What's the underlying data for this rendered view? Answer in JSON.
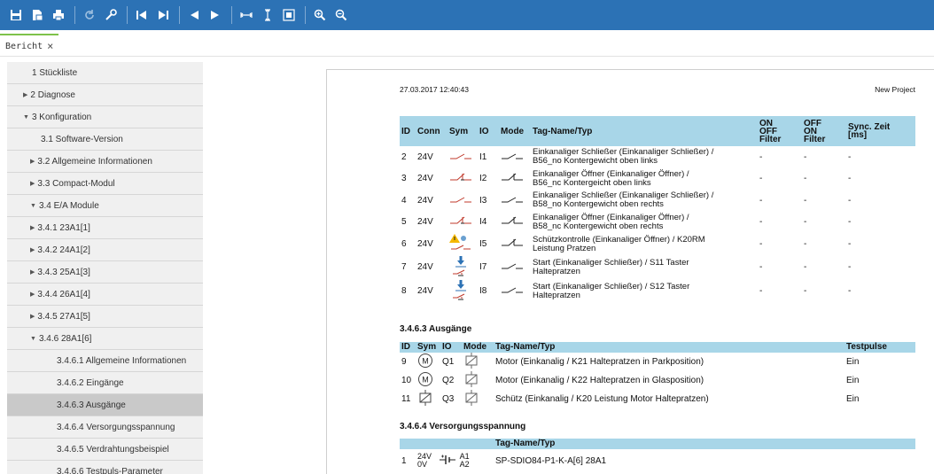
{
  "toolbar": {
    "buttons": [
      "save-icon",
      "export-pdf-icon",
      "print-icon",
      "refresh-icon",
      "settings-wrench-icon",
      "first-page-icon",
      "last-page-icon",
      "previous-page-icon",
      "next-page-icon",
      "fit-width-icon",
      "fit-height-icon",
      "fit-page-icon",
      "zoom-in-icon",
      "zoom-out-icon"
    ]
  },
  "tab": {
    "label": "Bericht",
    "close": "×"
  },
  "sidebar": {
    "items": [
      {
        "label": "1 Stückliste",
        "arrow": ""
      },
      {
        "label": "2 Diagnose",
        "arrow": "▶"
      },
      {
        "label": "3 Konfiguration",
        "arrow": "▼"
      },
      {
        "label": "3.1 Software-Version",
        "arrow": ""
      },
      {
        "label": "3.2 Allgemeine Informationen",
        "arrow": "▶"
      },
      {
        "label": "3.3 Compact-Modul",
        "arrow": "▶"
      },
      {
        "label": "3.4 E/A Module",
        "arrow": "▼"
      },
      {
        "label": "3.4.1 23A1[1]",
        "arrow": "▶"
      },
      {
        "label": "3.4.2 24A1[2]",
        "arrow": "▶"
      },
      {
        "label": "3.4.3 25A1[3]",
        "arrow": "▶"
      },
      {
        "label": "3.4.4 26A1[4]",
        "arrow": "▶"
      },
      {
        "label": "3.4.5 27A1[5]",
        "arrow": "▶"
      },
      {
        "label": "3.4.6 28A1[6]",
        "arrow": "▼"
      },
      {
        "label": "3.4.6.1 Allgemeine Informationen",
        "arrow": ""
      },
      {
        "label": "3.4.6.2 Eingänge",
        "arrow": ""
      },
      {
        "label": "3.4.6.3 Ausgänge",
        "arrow": ""
      },
      {
        "label": "3.4.6.4 Versorgungsspannung",
        "arrow": ""
      },
      {
        "label": "3.4.6.5 Verdrahtungsbeispiel",
        "arrow": ""
      },
      {
        "label": "3.4.6.6 Testpuls-Parameter",
        "arrow": ""
      }
    ]
  },
  "report": {
    "timestamp": "27.03.2017 12:40:43",
    "project": "New Project",
    "inputs": {
      "headers": {
        "id": "ID",
        "conn": "Conn",
        "sym": "Sym",
        "io": "IO",
        "mode": "Mode",
        "tag": "Tag-Name/Typ",
        "on_off_1": "ON",
        "on_off_2": "OFF",
        "on_off_3": "Filter",
        "off_on_1": "OFF",
        "off_on_2": "ON",
        "off_on_3": "Filter",
        "sync_1": "Sync. Zeit",
        "sync_2": "[ms]"
      },
      "rows": [
        {
          "id": "2",
          "conn": "24V",
          "io": "I1",
          "tag1": "Einkanaliger Schließer (Einkanaliger Schließer) /",
          "tag2": "B56_no Kontergewicht oben links",
          "on": "-",
          "off": "-",
          "sync": "-"
        },
        {
          "id": "3",
          "conn": "24V",
          "io": "I2",
          "tag1": "Einkanaliger Öffner (Einkanaliger Öffner) /",
          "tag2": "B56_nc Kontergeicht oben links",
          "on": "-",
          "off": "-",
          "sync": "-"
        },
        {
          "id": "4",
          "conn": "24V",
          "io": "I3",
          "tag1": "Einkanaliger Schließer (Einkanaliger Schließer) /",
          "tag2": "B58_no Kontergewicht oben rechts",
          "on": "-",
          "off": "-",
          "sync": "-"
        },
        {
          "id": "5",
          "conn": "24V",
          "io": "I4",
          "tag1": "Einkanaliger Öffner (Einkanaliger Öffner) /",
          "tag2": "B58_nc Kontergewicht oben rechts",
          "on": "-",
          "off": "-",
          "sync": "-"
        },
        {
          "id": "6",
          "conn": "24V",
          "io": "I5",
          "tag1": "Schützkontrolle (Einkanaliger Öffner) / K20RM",
          "tag2": "Leistung Pratzen",
          "on": "-",
          "off": "-",
          "sync": "-"
        },
        {
          "id": "7",
          "conn": "24V",
          "io": "I7",
          "tag1": "Start (Einkanaliger Schließer) / S11 Taster",
          "tag2": "Haltepratzen",
          "on": "-",
          "off": "-",
          "sync": "-"
        },
        {
          "id": "8",
          "conn": "24V",
          "io": "I8",
          "tag1": "Start (Einkanaliger Schließer) / S12 Taster",
          "tag2": "Haltepratzen",
          "on": "-",
          "off": "-",
          "sync": "-"
        }
      ]
    },
    "outputs": {
      "title": "3.4.6.3 Ausgänge",
      "headers": {
        "id": "ID",
        "sym": "Sym",
        "io": "IO",
        "mode": "Mode",
        "tag": "Tag-Name/Typ",
        "testpulse": "Testpulse"
      },
      "rows": [
        {
          "id": "9",
          "io": "Q1",
          "tag": "Motor (Einkanalig / K21 Haltepratzen in Parkposition)",
          "testpulse": "Ein"
        },
        {
          "id": "10",
          "io": "Q2",
          "tag": "Motor (Einkanalig / K22 Haltepratzen in Glasposition)",
          "testpulse": "Ein"
        },
        {
          "id": "11",
          "io": "Q3",
          "tag": "Schütz (Einkanalig / K20 Leistung Motor Haltepratzen)",
          "testpulse": "Ein"
        }
      ]
    },
    "supply": {
      "title": "3.4.6.4 Versorgungsspannung",
      "header_tag": "Tag-Name/Typ",
      "row": {
        "id": "1",
        "v1": "24V",
        "v2": "0V",
        "a1": "A1",
        "a2": "A2",
        "tag": "SP-SDIO84-P1-K-A[6] 28A1"
      }
    }
  }
}
